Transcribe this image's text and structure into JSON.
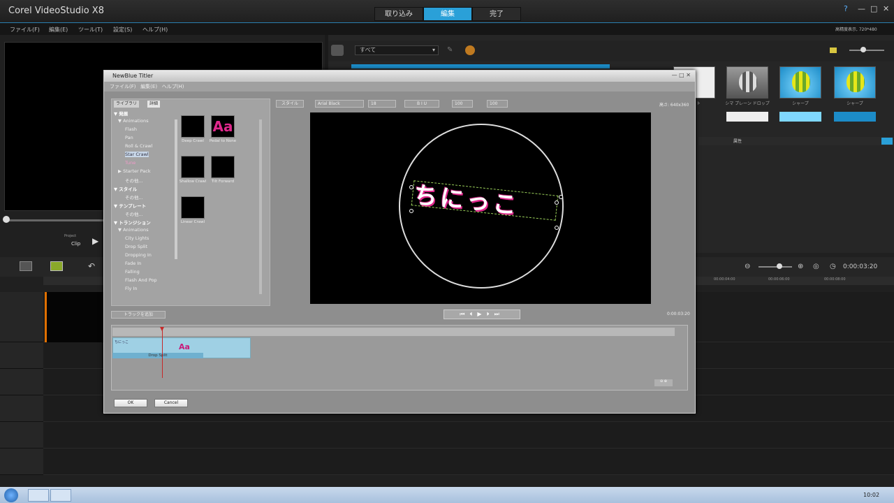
{
  "app": {
    "title": "Corel VideoStudio X8",
    "tabs": [
      "取り込み",
      "編集",
      "完了"
    ],
    "active_tab": "編集",
    "window_controls": [
      "?",
      "—",
      "□",
      "✕"
    ],
    "accent_color": "#2aa0d8"
  },
  "menu": {
    "items": [
      "ファイル(F)",
      "編集(E)",
      "ツール(T)",
      "設定(S)",
      "ヘルプ(H)"
    ],
    "right_info": "高精度表示, 720*480"
  },
  "preview": {
    "mode_top": "Project",
    "mode_bottom": "Clip"
  },
  "library": {
    "category_select": "すべて",
    "thumbnails": [
      {
        "label": "ネット",
        "style": "white"
      },
      {
        "label": "シマ プレーン ドロップ",
        "style": "grey"
      },
      {
        "label": "シャープ",
        "style": "blue"
      },
      {
        "label": "シャープ",
        "style": "blue"
      }
    ],
    "attribute_label": "属性"
  },
  "timeline": {
    "timecode": "0:00:03:20",
    "ruler_marks": [
      "00:00:04:00",
      "00:00:06:00",
      "00:00:08:00"
    ]
  },
  "dialog": {
    "title": "NewBlue Titler",
    "menu": [
      "ファイル(F)",
      "編集(E)",
      "ヘルプ(H)"
    ],
    "tabs": [
      "ライブラリ",
      "詳細"
    ],
    "tree": [
      {
        "text": "▼ 発展",
        "level": 0,
        "type": "head"
      },
      {
        "text": "▼ Animations",
        "level": 1
      },
      {
        "text": "Flash",
        "level": 2
      },
      {
        "text": "Pan",
        "level": 2
      },
      {
        "text": "Roll & Crawl",
        "level": 2
      },
      {
        "text": "Star Crawl",
        "level": 2,
        "type": "sel"
      },
      {
        "text": "Tune",
        "level": 2,
        "type": "pink"
      },
      {
        "text": "▶ Starter Pack",
        "level": 1
      },
      {
        "text": "その他...",
        "level": 2
      },
      {
        "text": "▼ スタイル",
        "level": 0,
        "type": "head"
      },
      {
        "text": "その他...",
        "level": 2
      },
      {
        "text": "▼ テンプレート",
        "level": 0,
        "type": "head"
      },
      {
        "text": "その他...",
        "level": 2
      },
      {
        "text": "▼ トランジション",
        "level": 0,
        "type": "head"
      },
      {
        "text": "▼ Animations",
        "level": 1
      },
      {
        "text": "City Lights",
        "level": 2
      },
      {
        "text": "Drop Split",
        "level": 2
      },
      {
        "text": "Dropping In",
        "level": 2
      },
      {
        "text": "Fade In",
        "level": 2
      },
      {
        "text": "Falling",
        "level": 2
      },
      {
        "text": "Flash And Pop",
        "level": 2
      },
      {
        "text": "Fly In",
        "level": 2
      }
    ],
    "animations": [
      {
        "label": "Deep Crawl",
        "icon": ""
      },
      {
        "label": "Pedal to None",
        "icon": "Aa"
      },
      {
        "label": "Shallow Crawl",
        "icon": ""
      },
      {
        "label": "Tilt Forward",
        "icon": ""
      },
      {
        "label": "Linear Crawl",
        "icon": ""
      }
    ],
    "toolbar": {
      "style_btn": "スタイル",
      "font": "Arial Black",
      "size": "18",
      "format": "B  I  U",
      "tracking": "100",
      "leading": "100"
    },
    "resolution": "高さ: 640x360",
    "title_text": "ちにっこ",
    "playback": "⏮⏴▶⏵⏭",
    "time": "0:00:03:20",
    "add_track": "トラックを追加",
    "track_name": "ちにっこ",
    "track_effect": "Drop Split",
    "track_icon": "Aa",
    "ok": "OK",
    "cancel": "Cancel",
    "zoom": "⊖ ⊕"
  },
  "taskbar": {
    "time": "10:02"
  }
}
